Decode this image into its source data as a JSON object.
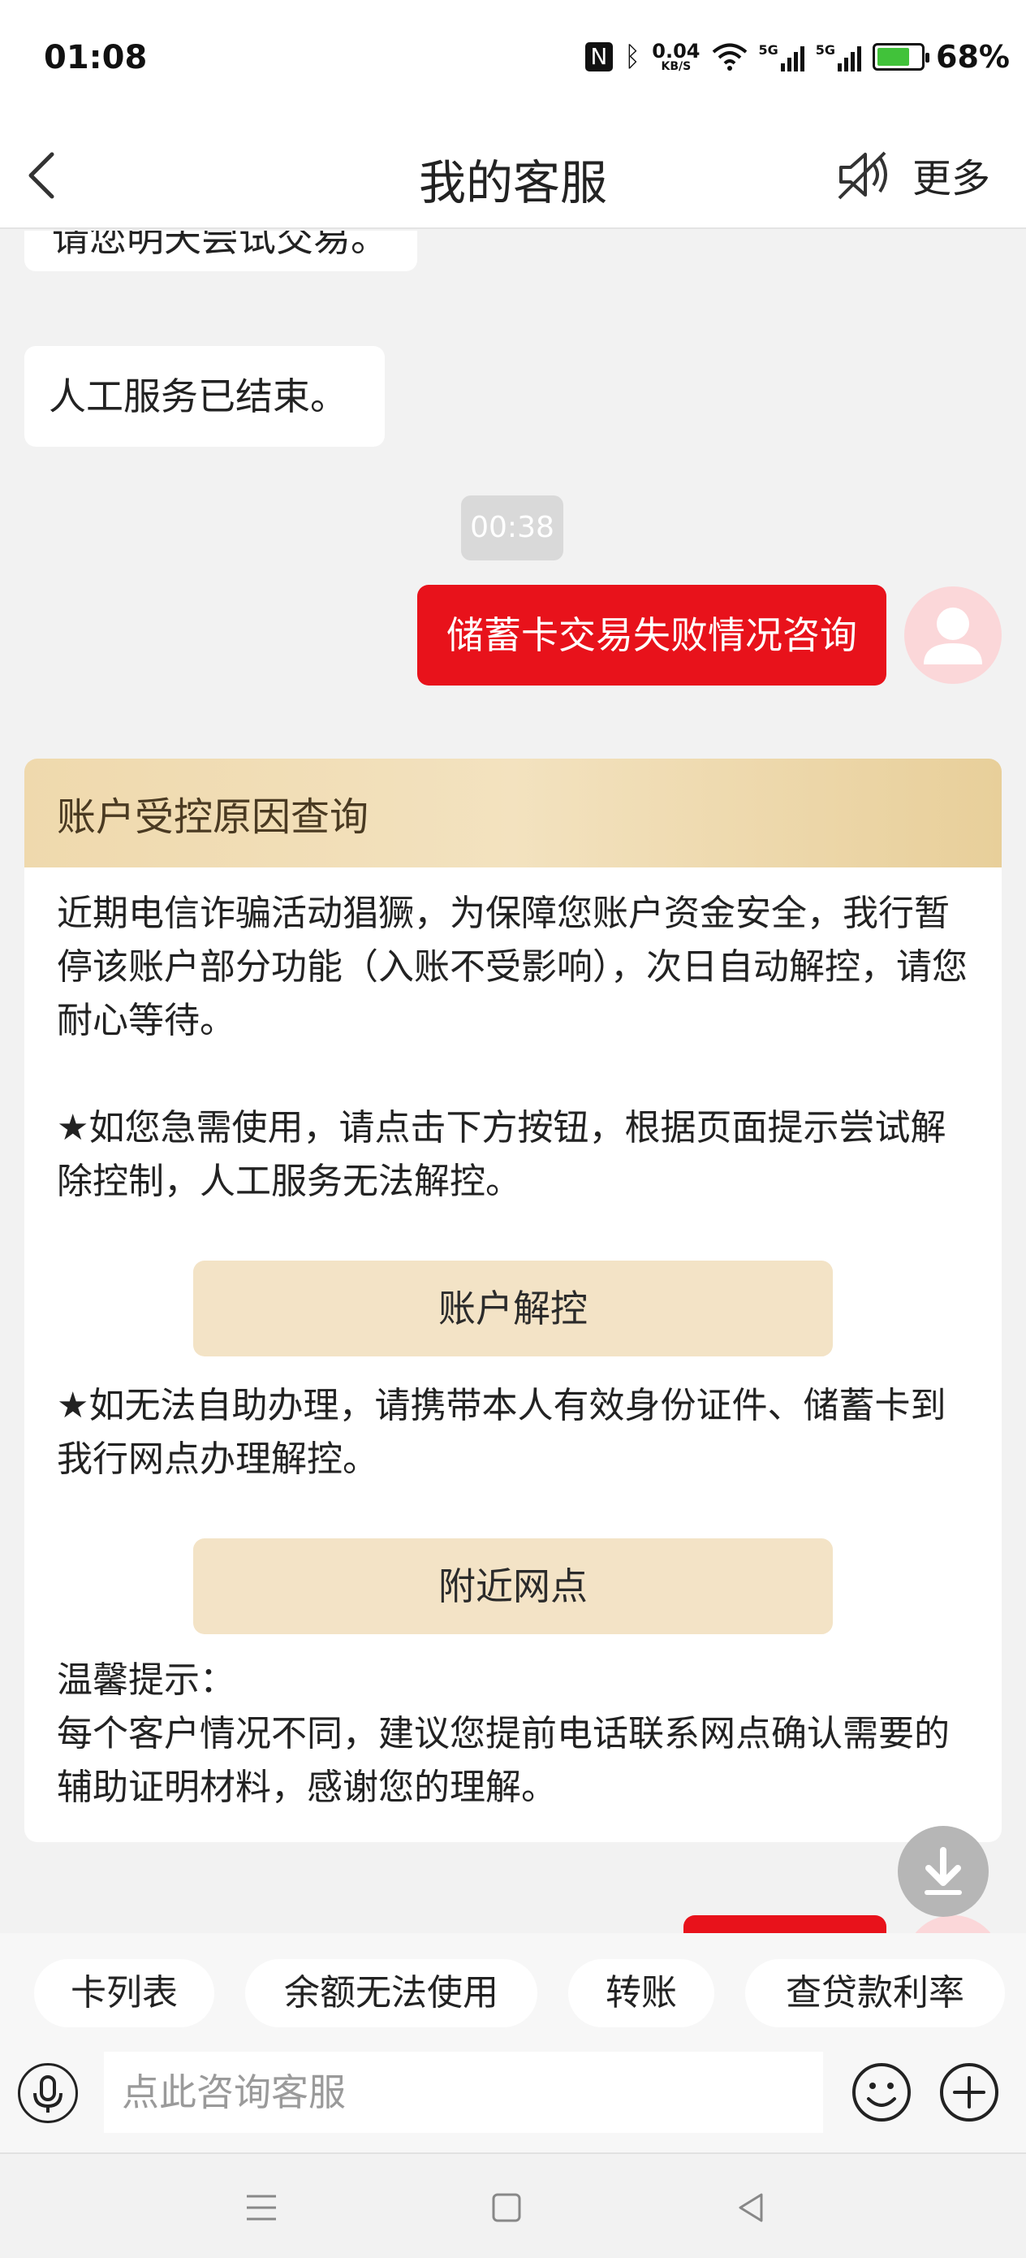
{
  "status_bar": {
    "time": "01:08",
    "net_speed": "0.04",
    "net_unit": "KB/S",
    "signal1": "5G",
    "signal2": "5G",
    "battery": "68%"
  },
  "header": {
    "title": "我的客服",
    "more_label": "更多"
  },
  "messages": {
    "partial_text": "请您明天尝试交易。",
    "service_ended": "人工服务已结束。",
    "timestamp": "00:38",
    "user_query": "储蓄卡交易失败情况咨询"
  },
  "card": {
    "title": "账户受控原因查询",
    "para1": "近期电信诈骗活动猖獗，为保障您账户资金安全，我行暂停该账户部分功能（入账不受影响），次日自动解控，请您耐心等待。",
    "para2": "★如您急需使用，请点击下方按钮，根据页面提示尝试解除控制，人工服务无法解控。",
    "button1": "账户解控",
    "para3": "★如无法自助办理，请携带本人有效身份证件、储蓄卡到我行网点办理解控。",
    "button2": "附近网点",
    "tip_title": "温馨提示：",
    "tip_body": "每个客户情况不同，建议您提前电话联系网点确认需要的辅助证明材料，感谢您的理解。"
  },
  "quick_replies": [
    "卡列表",
    "余额无法使用",
    "转账",
    "查贷款利率"
  ],
  "input": {
    "placeholder": "点此咨询客服"
  },
  "colors": {
    "accent_red": "#e8121b",
    "card_header": "#efd9ad",
    "card_button": "#f3e3c6"
  },
  "icons": [
    "back-icon",
    "speaker-muted-icon",
    "user-avatar-icon",
    "download-icon",
    "mic-icon",
    "emoji-icon",
    "plus-icon",
    "menu-icon",
    "home-icon",
    "back-nav-icon"
  ]
}
